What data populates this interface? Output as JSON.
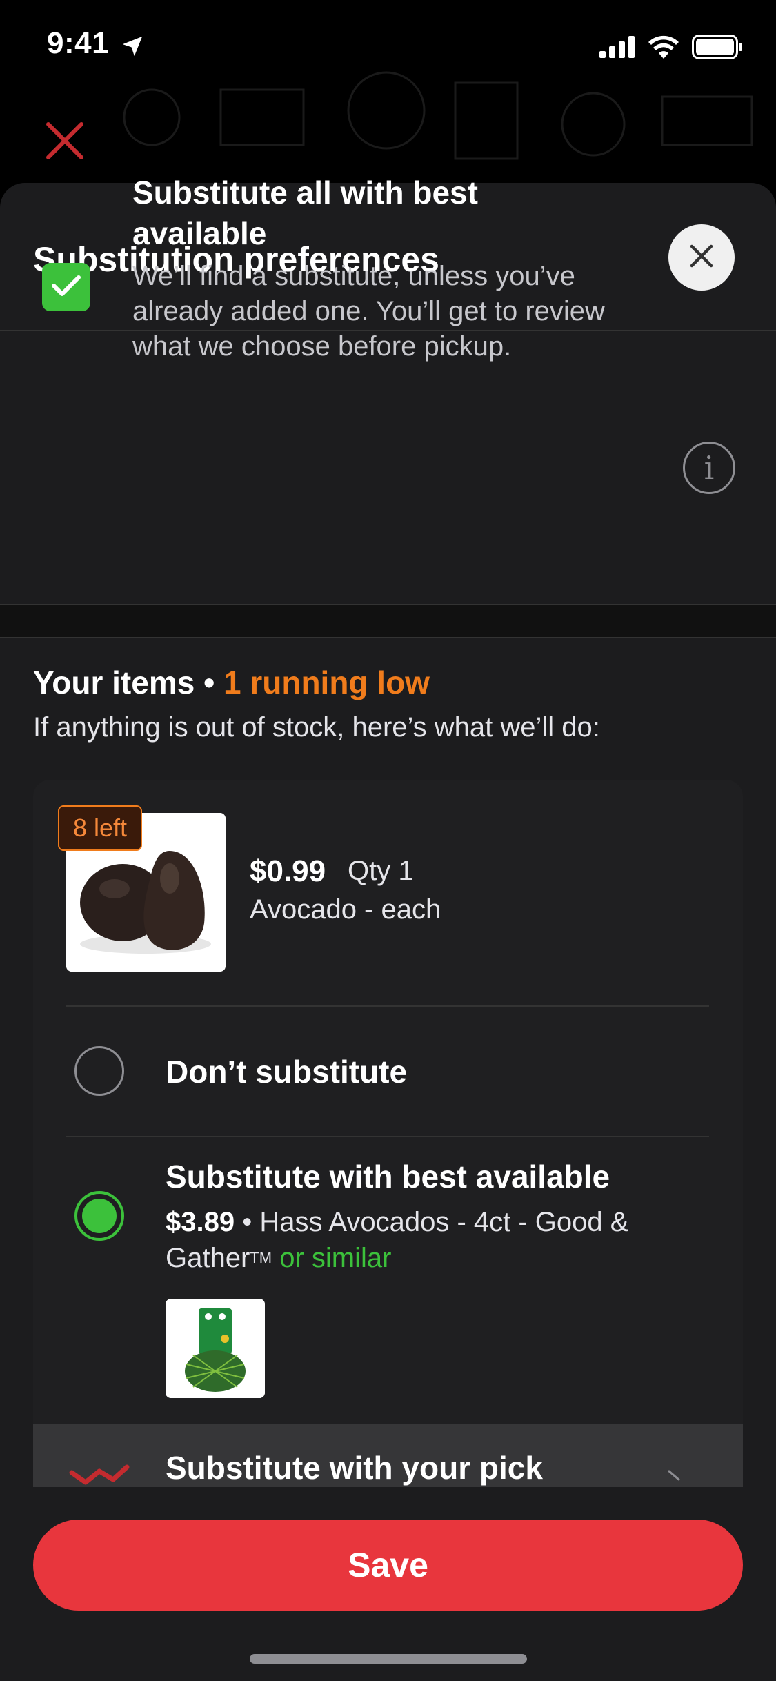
{
  "status_bar": {
    "time": "9:41"
  },
  "sheet": {
    "title": "Substitution preferences"
  },
  "substitute_all": {
    "checked": true,
    "title": "Substitute all with best available",
    "description": "We’ll find a substitute, unless you’ve already added one. You’ll get to review what we choose before pickup."
  },
  "items": {
    "title": "Your items",
    "separator": "•",
    "running_low": "1 running low",
    "subtitle": "If anything is out of stock, here’s what we’ll do:"
  },
  "product": {
    "badge": "8 left",
    "price": "$0.99",
    "qty": "Qty 1",
    "name": "Avocado - each"
  },
  "options": {
    "dont_substitute": {
      "label": "Don’t substitute",
      "selected": false
    },
    "best_available": {
      "label": "Substitute with best available",
      "selected": true,
      "price": "$3.89",
      "separator": "•",
      "product": "Hass Avocados - 4ct - Good & Gather",
      "trademark": "TM",
      "or_similar": "or similar"
    },
    "your_pick": {
      "label": "Substitute with your pick"
    }
  },
  "save_button": {
    "label": "Save"
  },
  "colors": {
    "accent_green": "#3cc13b",
    "accent_orange": "#f07c1c",
    "save_red": "#e8363d",
    "sheet_bg": "#1c1c1e"
  }
}
